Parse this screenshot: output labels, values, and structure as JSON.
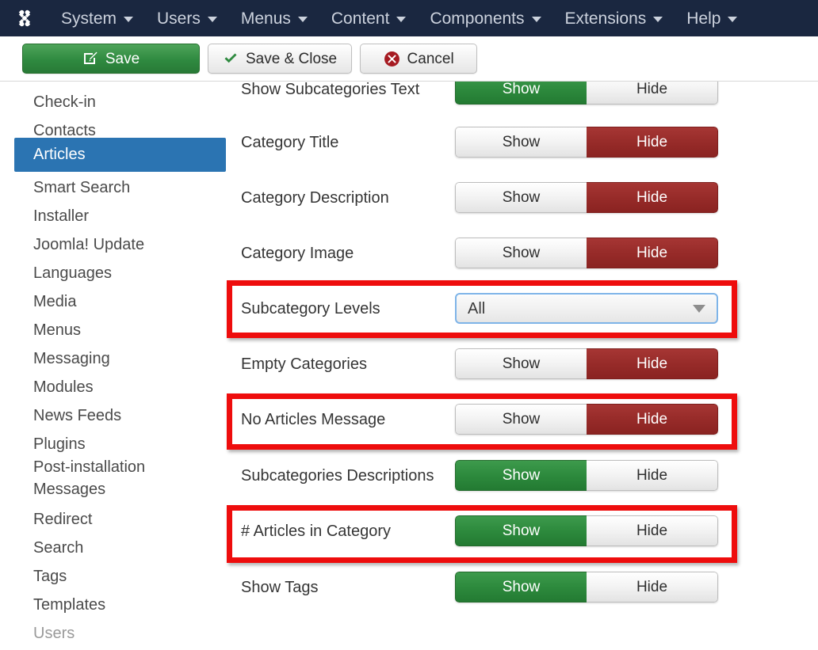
{
  "menubar": {
    "logo_icon": "joomla-logo-icon",
    "items": [
      {
        "label": "System",
        "caret": true
      },
      {
        "label": "Users",
        "caret": true
      },
      {
        "label": "Menus",
        "caret": true
      },
      {
        "label": "Content",
        "caret": true
      },
      {
        "label": "Components",
        "caret": true
      },
      {
        "label": "Extensions",
        "caret": true
      },
      {
        "label": "Help",
        "caret": true
      }
    ],
    "background": "#1a2740",
    "text_color": "#ccd2dd"
  },
  "toolbar": {
    "save_label": "Save",
    "save_icon": "pencil-edit-icon",
    "save_close_label": "Save & Close",
    "save_close_icon": "check-icon",
    "cancel_label": "Cancel",
    "cancel_icon": "cancel-circle-icon",
    "save_color": "#2f8a40"
  },
  "sidebar": {
    "items": [
      {
        "label": "Check-in",
        "active": false,
        "muted": false
      },
      {
        "label": "Contacts",
        "active": false,
        "muted": false
      },
      {
        "label": "Articles",
        "active": true,
        "muted": false
      },
      {
        "label": "Smart Search",
        "active": false,
        "muted": false
      },
      {
        "label": "Installer",
        "active": false,
        "muted": false
      },
      {
        "label": "Joomla! Update",
        "active": false,
        "muted": false
      },
      {
        "label": "Languages",
        "active": false,
        "muted": false
      },
      {
        "label": "Media",
        "active": false,
        "muted": false
      },
      {
        "label": "Menus",
        "active": false,
        "muted": false
      },
      {
        "label": "Messaging",
        "active": false,
        "muted": false
      },
      {
        "label": "Modules",
        "active": false,
        "muted": false
      },
      {
        "label": "News Feeds",
        "active": false,
        "muted": false
      },
      {
        "label": "Plugins",
        "active": false,
        "muted": false
      },
      {
        "label": "Post-installation Messages",
        "active": false,
        "muted": false
      },
      {
        "label": "Redirect",
        "active": false,
        "muted": false
      },
      {
        "label": "Search",
        "active": false,
        "muted": false
      },
      {
        "label": "Tags",
        "active": false,
        "muted": false
      },
      {
        "label": "Templates",
        "active": false,
        "muted": false
      },
      {
        "label": "Users",
        "active": false,
        "muted": true
      }
    ],
    "active_color": "#2b74b2"
  },
  "form": {
    "toggle_on_label": "Show",
    "toggle_off_label": "Hide",
    "rows": [
      {
        "label": "Show Subcategories Text",
        "type": "toggle",
        "value": "Show",
        "clipped": true
      },
      {
        "label": "Category Title",
        "type": "toggle",
        "value": "Hide"
      },
      {
        "label": "Category Description",
        "type": "toggle",
        "value": "Hide"
      },
      {
        "label": "Category Image",
        "type": "toggle",
        "value": "Hide"
      },
      {
        "label": "Subcategory Levels",
        "type": "select",
        "value": "All",
        "focused": true
      },
      {
        "label": "Empty Categories",
        "type": "toggle",
        "value": "Hide"
      },
      {
        "label": "No Articles Message",
        "type": "toggle",
        "value": "Hide"
      },
      {
        "label": "Subcategories Descriptions",
        "type": "toggle",
        "value": "Show"
      },
      {
        "label": "# Articles in Category",
        "type": "toggle",
        "value": "Show"
      },
      {
        "label": "Show Tags",
        "type": "toggle",
        "value": "Show"
      }
    ]
  },
  "highlights": {
    "color": "#ee0d0d",
    "boxes": [
      {
        "target": "Subcategory Levels"
      },
      {
        "target": "No Articles Message"
      },
      {
        "target": "# Articles in Category"
      }
    ]
  }
}
